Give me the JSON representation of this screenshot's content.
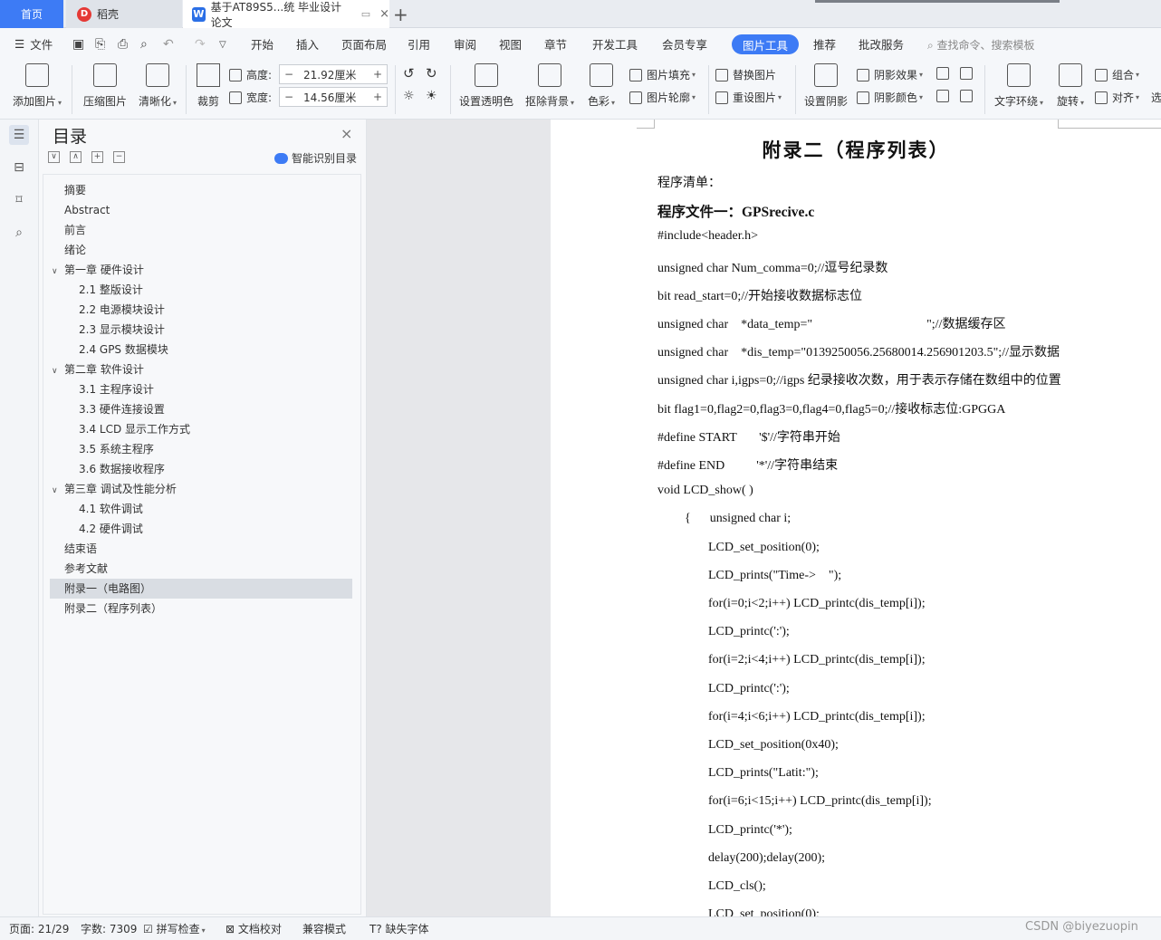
{
  "tabs": {
    "home": "首页",
    "docer": "稻壳",
    "doc": "基于AT89S5...统 毕业设计论文"
  },
  "menu": {
    "file": "文件",
    "items": [
      "开始",
      "插入",
      "页面布局",
      "引用",
      "审阅",
      "视图",
      "章节",
      "开发工具",
      "会员专享",
      "图片工具",
      "推荐",
      "批改服务"
    ],
    "search_placeholder": "查找命令、搜索模板"
  },
  "ribbon": {
    "add_picture": "添加图片",
    "compress": "压缩图片",
    "sharpen": "清晰化",
    "crop": "裁剪",
    "height_label": "高度:",
    "height_value": "21.92厘米",
    "width_label": "宽度:",
    "width_value": "14.56厘米",
    "transparent": "设置透明色",
    "remove_bg": "抠除背景",
    "color": "色彩",
    "fill": "图片填充",
    "outline": "图片轮廓",
    "replace": "替换图片",
    "reset": "重设图片",
    "shadow_set": "设置阴影",
    "shadow_effect": "阴影效果",
    "shadow_color": "阴影颜色",
    "wrap": "文字环绕",
    "rotate": "旋转",
    "group": "组合",
    "align": "对齐",
    "more": "选"
  },
  "toc": {
    "title": "目录",
    "smart": "智能识别目录",
    "items": [
      {
        "label": "摘要",
        "level": 1,
        "arrow": ""
      },
      {
        "label": "Abstract",
        "level": 1,
        "arrow": ""
      },
      {
        "label": "前言",
        "level": 1,
        "arrow": ""
      },
      {
        "label": "绪论",
        "level": 1,
        "arrow": ""
      },
      {
        "label": "第一章  硬件设计",
        "level": 0,
        "arrow": "∨"
      },
      {
        "label": "2.1  整版设计",
        "level": 2,
        "arrow": ""
      },
      {
        "label": "2.2  电源模块设计",
        "level": 2,
        "arrow": ""
      },
      {
        "label": "2.3  显示模块设计",
        "level": 2,
        "arrow": ""
      },
      {
        "label": "2.4 GPS 数据模块",
        "level": 2,
        "arrow": ""
      },
      {
        "label": "第二章  软件设计",
        "level": 0,
        "arrow": "∨"
      },
      {
        "label": "3.1  主程序设计",
        "level": 2,
        "arrow": ""
      },
      {
        "label": "3.3  硬件连接设置",
        "level": 2,
        "arrow": ""
      },
      {
        "label": "3.4 LCD 显示工作方式",
        "level": 2,
        "arrow": ""
      },
      {
        "label": "3.5  系统主程序",
        "level": 2,
        "arrow": ""
      },
      {
        "label": "3.6  数据接收程序",
        "level": 2,
        "arrow": ""
      },
      {
        "label": "第三章   调试及性能分析",
        "level": 0,
        "arrow": "∨"
      },
      {
        "label": "4.1 软件调试",
        "level": 2,
        "arrow": ""
      },
      {
        "label": "4.2 硬件调试",
        "level": 2,
        "arrow": ""
      },
      {
        "label": "结束语",
        "level": 1,
        "arrow": ""
      },
      {
        "label": "参考文献",
        "level": 1,
        "arrow": ""
      },
      {
        "label": "附录一（电路图）",
        "level": 1,
        "arrow": ""
      },
      {
        "label": "附录二（程序列表）",
        "level": 1,
        "arrow": ""
      }
    ]
  },
  "document": {
    "title": "附录二（程序列表）",
    "lines": [
      {
        "text": "程序清单：",
        "indent": 0,
        "bold": false
      },
      {
        "text": "程序文件一：GPSrecive.c",
        "indent": 0,
        "bold": true
      },
      {
        "text": "#include<header.h>",
        "indent": 0,
        "bold": false
      },
      {
        "text": "unsigned char Num_comma=0;//逗号纪录数",
        "indent": 0,
        "bold": false
      },
      {
        "text": "bit read_start=0;//开始接收数据标志位",
        "indent": 0,
        "bold": false
      },
      {
        "text": "unsigned char    *data_temp=\"                                    \";//数据缓存区",
        "indent": 0,
        "bold": false
      },
      {
        "text": "unsigned char    *dis_temp=\"0139250056.25680014.256901203.5\";//显示数据",
        "indent": 0,
        "bold": false
      },
      {
        "text": "unsigned char i,igps=0;//igps 纪录接收次数，用于表示存储在数组中的位置",
        "indent": 0,
        "bold": false
      },
      {
        "text": "bit flag1=0,flag2=0,flag3=0,flag4=0,flag5=0;//接收标志位:GPGGA",
        "indent": 0,
        "bold": false
      },
      {
        "text": "#define START       '$'//字符串开始",
        "indent": 0,
        "bold": false
      },
      {
        "text": "#define END          '*'//字符串结束",
        "indent": 0,
        "bold": false
      },
      {
        "text": "void LCD_show( )",
        "indent": 0,
        "bold": false
      },
      {
        "text": "{      unsigned char i;",
        "indent": 1,
        "bold": false
      },
      {
        "text": "LCD_set_position(0);",
        "indent": 2,
        "bold": false
      },
      {
        "text": "LCD_prints(\"Time->    \");",
        "indent": 2,
        "bold": false
      },
      {
        "text": "for(i=0;i<2;i++) LCD_printc(dis_temp[i]);",
        "indent": 2,
        "bold": false
      },
      {
        "text": "LCD_printc(':');",
        "indent": 2,
        "bold": false
      },
      {
        "text": "for(i=2;i<4;i++) LCD_printc(dis_temp[i]);",
        "indent": 2,
        "bold": false
      },
      {
        "text": "LCD_printc(':');",
        "indent": 2,
        "bold": false
      },
      {
        "text": "for(i=4;i<6;i++) LCD_printc(dis_temp[i]);",
        "indent": 2,
        "bold": false
      },
      {
        "text": "LCD_set_position(0x40);",
        "indent": 2,
        "bold": false
      },
      {
        "text": "LCD_prints(\"Latit:\");",
        "indent": 2,
        "bold": false
      },
      {
        "text": "for(i=6;i<15;i++) LCD_printc(dis_temp[i]);",
        "indent": 2,
        "bold": false
      },
      {
        "text": "LCD_printc('*');",
        "indent": 2,
        "bold": false
      },
      {
        "text": "delay(200);delay(200);",
        "indent": 2,
        "bold": false
      },
      {
        "text": "LCD_cls();",
        "indent": 2,
        "bold": false
      },
      {
        "text": "LCD_set_position(0);",
        "indent": 2,
        "bold": false
      }
    ]
  },
  "status": {
    "page": "页面: 21/29",
    "words": "字数: 7309",
    "spell": "拼写检查",
    "proof": "文档校对",
    "compat": "兼容模式",
    "missing_font": "缺失字体"
  },
  "watermark": "CSDN @biyezuopin"
}
